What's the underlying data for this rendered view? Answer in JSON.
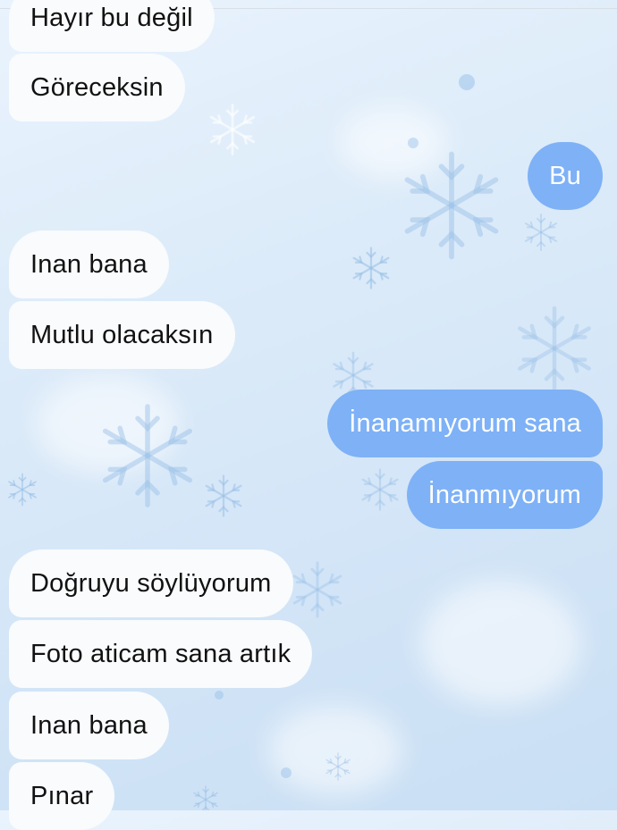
{
  "chat": {
    "messages": [
      {
        "sender": "them",
        "text": "Hayır bu değil"
      },
      {
        "sender": "them",
        "text": "Göreceksin"
      },
      {
        "sender": "me",
        "text": "Bu"
      },
      {
        "sender": "them",
        "text": "Inan bana"
      },
      {
        "sender": "them",
        "text": "Mutlu olacaksın"
      },
      {
        "sender": "me",
        "text": "İnanamıyorum sana"
      },
      {
        "sender": "me",
        "text": "İnanmıyorum"
      },
      {
        "sender": "them",
        "text": "Doğruyu söylüyorum"
      },
      {
        "sender": "them",
        "text": "Foto aticam sana artık"
      },
      {
        "sender": "them",
        "text": "Inan bana"
      },
      {
        "sender": "them",
        "text": "Pınar"
      }
    ]
  },
  "theme": {
    "wallpaper": "snowflake",
    "incoming_bubble_color": "#f9fbfd",
    "outgoing_bubble_color": "#7eb1f6",
    "background_color": "#dcebf9"
  }
}
